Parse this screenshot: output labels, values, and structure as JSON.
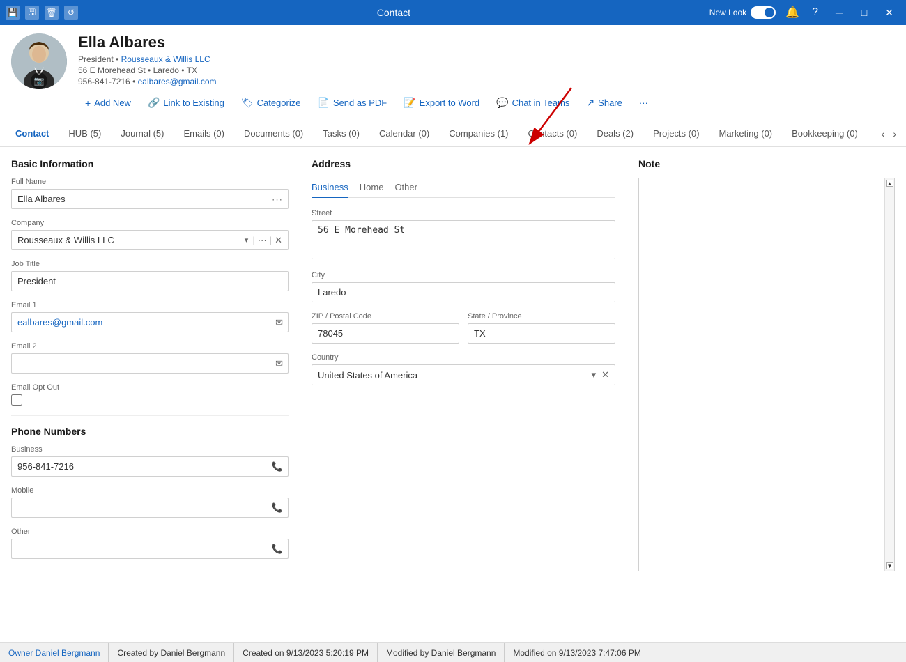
{
  "titleBar": {
    "title": "Contact",
    "newLook": "New Look",
    "icons": [
      "save",
      "save-as",
      "delete",
      "refresh"
    ]
  },
  "contactHeader": {
    "name": "Ella Albares",
    "title": "President",
    "company": "Rousseaux & Willis LLC",
    "address": "56 E Morehead St • Laredo • TX",
    "phone": "956-841-7216",
    "email": "ealbares@gmail.com",
    "actions": [
      {
        "id": "add-new",
        "label": "Add New",
        "icon": "+"
      },
      {
        "id": "link-to-existing",
        "label": "Link to Existing",
        "icon": "🔗"
      },
      {
        "id": "categorize",
        "label": "Categorize",
        "icon": "🏷"
      },
      {
        "id": "send-as-pdf",
        "label": "Send as PDF",
        "icon": "📄"
      },
      {
        "id": "export-to-word",
        "label": "Export to Word",
        "icon": "📝"
      },
      {
        "id": "chat-in-teams",
        "label": "Chat in Teams",
        "icon": "💬"
      },
      {
        "id": "share",
        "label": "Share",
        "icon": "↗"
      },
      {
        "id": "more",
        "label": "···",
        "icon": ""
      }
    ]
  },
  "navTabs": [
    {
      "id": "contact",
      "label": "Contact",
      "active": true
    },
    {
      "id": "hub",
      "label": "HUB (5)"
    },
    {
      "id": "journal",
      "label": "Journal (5)"
    },
    {
      "id": "emails",
      "label": "Emails (0)"
    },
    {
      "id": "documents",
      "label": "Documents (0)"
    },
    {
      "id": "tasks",
      "label": "Tasks (0)"
    },
    {
      "id": "calendar",
      "label": "Calendar (0)"
    },
    {
      "id": "companies",
      "label": "Companies (1)"
    },
    {
      "id": "contacts",
      "label": "Contacts (0)"
    },
    {
      "id": "deals",
      "label": "Deals (2)"
    },
    {
      "id": "projects",
      "label": "Projects (0)"
    },
    {
      "id": "marketing",
      "label": "Marketing (0)"
    },
    {
      "id": "bookkeeping",
      "label": "Bookkeeping (0)"
    }
  ],
  "basicInfo": {
    "sectionTitle": "Basic Information",
    "fields": {
      "fullNameLabel": "Full Name",
      "fullNameValue": "Ella Albares",
      "companyLabel": "Company",
      "companyValue": "Rousseaux & Willis LLC",
      "jobTitleLabel": "Job Title",
      "jobTitleValue": "President",
      "email1Label": "Email 1",
      "email1Value": "ealbares@gmail.com",
      "email2Label": "Email 2",
      "email2Value": "",
      "emailOptOutLabel": "Email Opt Out"
    }
  },
  "phoneNumbers": {
    "sectionTitle": "Phone Numbers",
    "fields": {
      "businessLabel": "Business",
      "businessValue": "956-841-7216",
      "mobileLabel": "Mobile",
      "mobileValue": "",
      "otherLabel": "Other",
      "otherValue": ""
    }
  },
  "address": {
    "sectionTitle": "Address",
    "tabs": [
      "Business",
      "Home",
      "Other"
    ],
    "activeTab": "Business",
    "fields": {
      "streetLabel": "Street",
      "streetValue": "56 E Morehead St",
      "cityLabel": "City",
      "cityValue": "Laredo",
      "zipLabel": "ZIP / Postal Code",
      "zipValue": "78045",
      "stateLabel": "State / Province",
      "stateValue": "TX",
      "countryLabel": "Country",
      "countryValue": "United States of America"
    }
  },
  "note": {
    "sectionTitle": "Note",
    "value": ""
  },
  "statusBar": {
    "owner": "Owner Daniel Bergmann",
    "createdBy": "Created by Daniel Bergmann",
    "createdOn": "Created on 9/13/2023 5:20:19 PM",
    "modifiedBy": "Modified by Daniel Bergmann",
    "modifiedOn": "Modified on 9/13/2023 7:47:06 PM"
  }
}
